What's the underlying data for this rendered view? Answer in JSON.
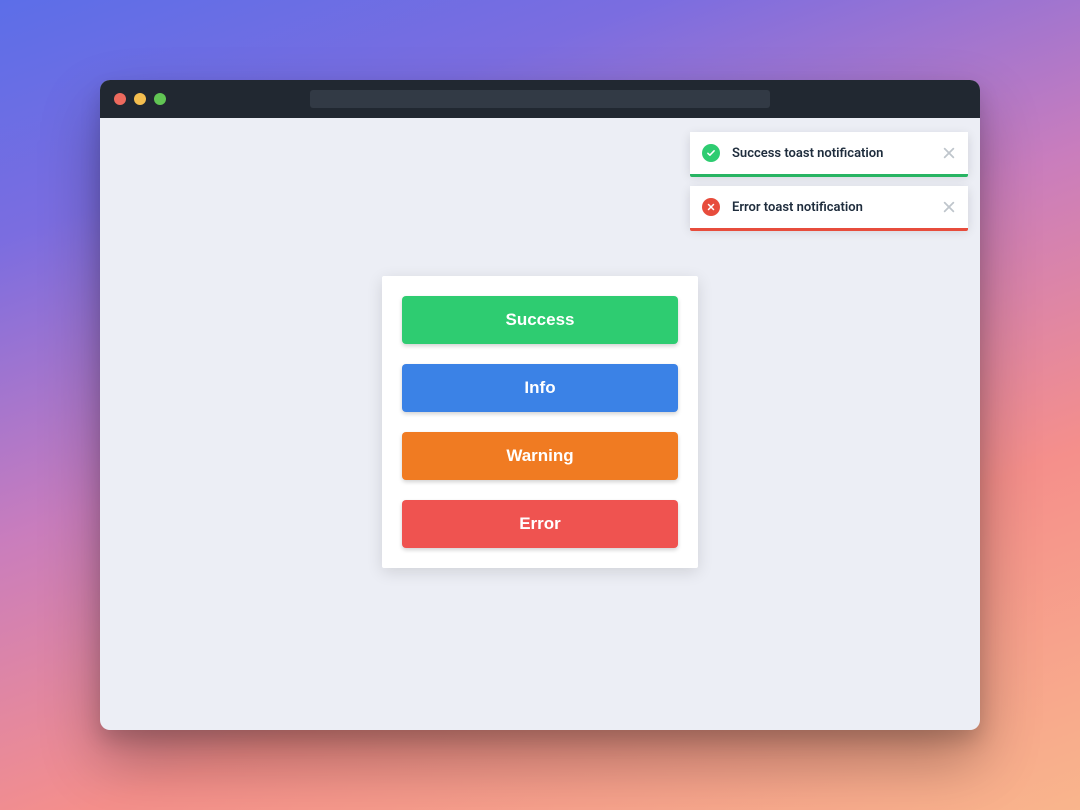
{
  "toasts": {
    "success": {
      "text": "Success toast notification"
    },
    "error": {
      "text": "Error toast notification"
    }
  },
  "buttons": {
    "success": {
      "label": "Success"
    },
    "info": {
      "label": "Info"
    },
    "warning": {
      "label": "Warning"
    },
    "error": {
      "label": "Error"
    }
  },
  "colors": {
    "success": "#2ecc71",
    "info": "#3b82e6",
    "warning": "#f07b22",
    "error": "#ef5350"
  }
}
